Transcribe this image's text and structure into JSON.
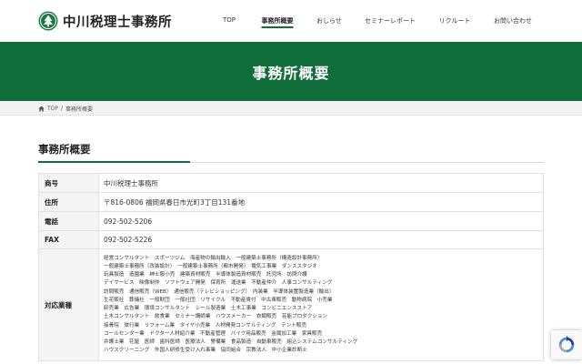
{
  "header": {
    "logo_text": "中川税理士事務所",
    "nav": [
      {
        "label": "TOP",
        "active": false
      },
      {
        "label": "事務所概要",
        "active": true
      },
      {
        "label": "おしらせ",
        "active": false
      },
      {
        "label": "セミナーレポート",
        "active": false
      },
      {
        "label": "リクルート",
        "active": false
      },
      {
        "label": "お問い合わせ",
        "active": false
      }
    ]
  },
  "hero": {
    "title": "事務所概要"
  },
  "breadcrumb": {
    "home": "TOP",
    "separator": "/",
    "current": "事務所概要"
  },
  "section": {
    "title": "事務所概要"
  },
  "table": {
    "rows": [
      {
        "label": "商号",
        "value": "中川税理士事務所"
      },
      {
        "label": "住所",
        "value": "〒816-0806 福岡県春日市光町3丁目131番地"
      },
      {
        "label": "電話",
        "value": "092-502-5206"
      },
      {
        "label": "FAX",
        "value": "092-502-5226"
      }
    ],
    "business": {
      "label": "対応業種",
      "lines": [
        "経営コンサルタント　スポーツジム　海産物の輸出輸入　一般建築士事務所（構造設計事務所）",
        "一般建築士事務所（改装設計）　一般建築士事務所（都市開発）　電気工事業　ダンススタジオ",
        "玩具製造　造園業　紳士服小売　建築資材販売　半導体製造資材販売　託児所　訪問介護",
        "デイサービス　映像制作　ソフトウェア開発　保育所　運送業　不動産仲介　人事コンサルティング",
        "訪問販売　通信販売（WEB）　通信販売（テレビショッピング）　内装業　半導体装置製造業（輸出）",
        "生花販社　葬儀社　一般財団　一般社団　リサイクル　不動産賃付　中古車販売　動物病院　小売業",
        "卸売業　広告業　環境コンサルタント　シール製造業　土木工事業　コンビニエンスストア",
        "土木コンサルタント　飲食業　セミナー講師業　ハウスメーカー　衣類販売　芸能プロダクション",
        "接骨院　旅行業　リフォーム業　タイヤ小売業　人材開発コンサルティング　テント販売",
        "コールセンター業　ドクター人材紹介業　不動産管理　バイク用品販売　金属加工業　家具販売",
        "弁護士業　花屋　医師　歯科医師　医療法人　警備業　食品製造　自動車販売　組込システムコンサルティング",
        "ハウスクリーニング　外国人研修生受け入れ事業　協同組合　宗教法人　中小企業診断士"
      ]
    }
  },
  "colors": {
    "brand_green": "#0f6e3a",
    "table_header_bg": "#f4f4f4",
    "breadcrumb_bg": "#f2f2f2"
  },
  "icons": {
    "logo": "green-circle-tree-icon",
    "breadcrumb_home": "home-icon",
    "recaptcha": "recaptcha-icon"
  }
}
